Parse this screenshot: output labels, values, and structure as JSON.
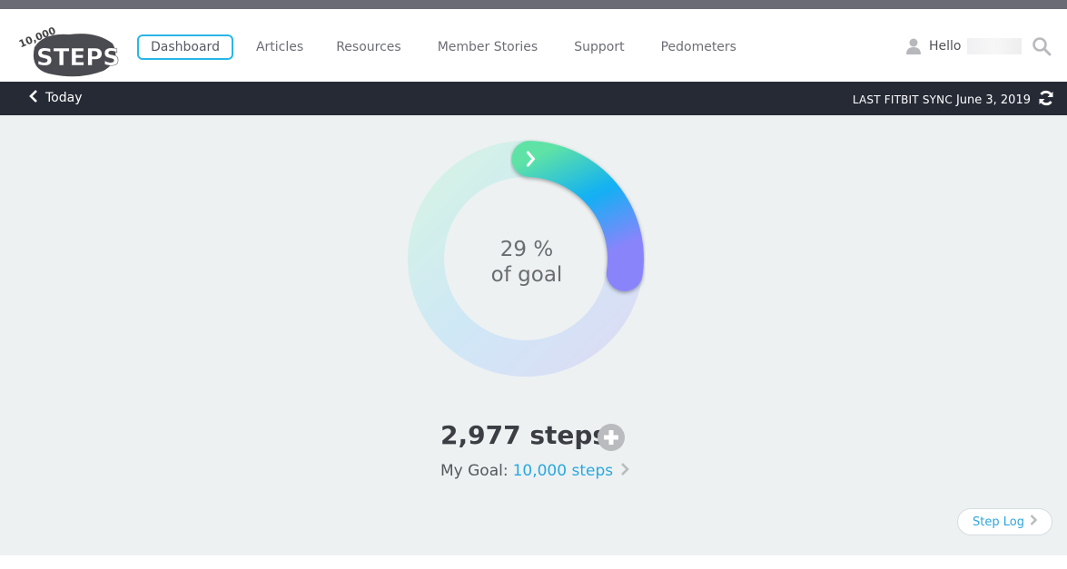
{
  "header": {
    "logo_alt": "10,000 Steps",
    "nav": [
      {
        "label": "Dashboard",
        "active": true
      },
      {
        "label": "Articles"
      },
      {
        "label": "Resources"
      },
      {
        "label": "Member Stories"
      },
      {
        "label": "Support"
      },
      {
        "label": "Pedometers"
      }
    ],
    "greeting": "Hello",
    "icons": {
      "user": "user-icon",
      "search": "search-icon"
    }
  },
  "subbar": {
    "back_label": "Today",
    "sync_label": "LAST FITBIT SYNC",
    "sync_date": "June 3, 2019",
    "icons": {
      "back": "chevron-left-icon",
      "refresh": "refresh-icon"
    }
  },
  "progress": {
    "percent_text": "29 %",
    "subtitle": "of goal",
    "fraction": 0.29
  },
  "summary": {
    "steps_text": "2,977 steps",
    "goal_label": "My Goal:",
    "goal_value": "10,000 steps",
    "icons": {
      "add": "plus-circle-icon",
      "goal_chevron": "chevron-right-icon"
    }
  },
  "step_log": {
    "label": "Step Log"
  },
  "colors": {
    "accent": "#29b6e8",
    "dark_bar": "#252a35",
    "background": "#edf1f2",
    "link": "#29a8df"
  }
}
